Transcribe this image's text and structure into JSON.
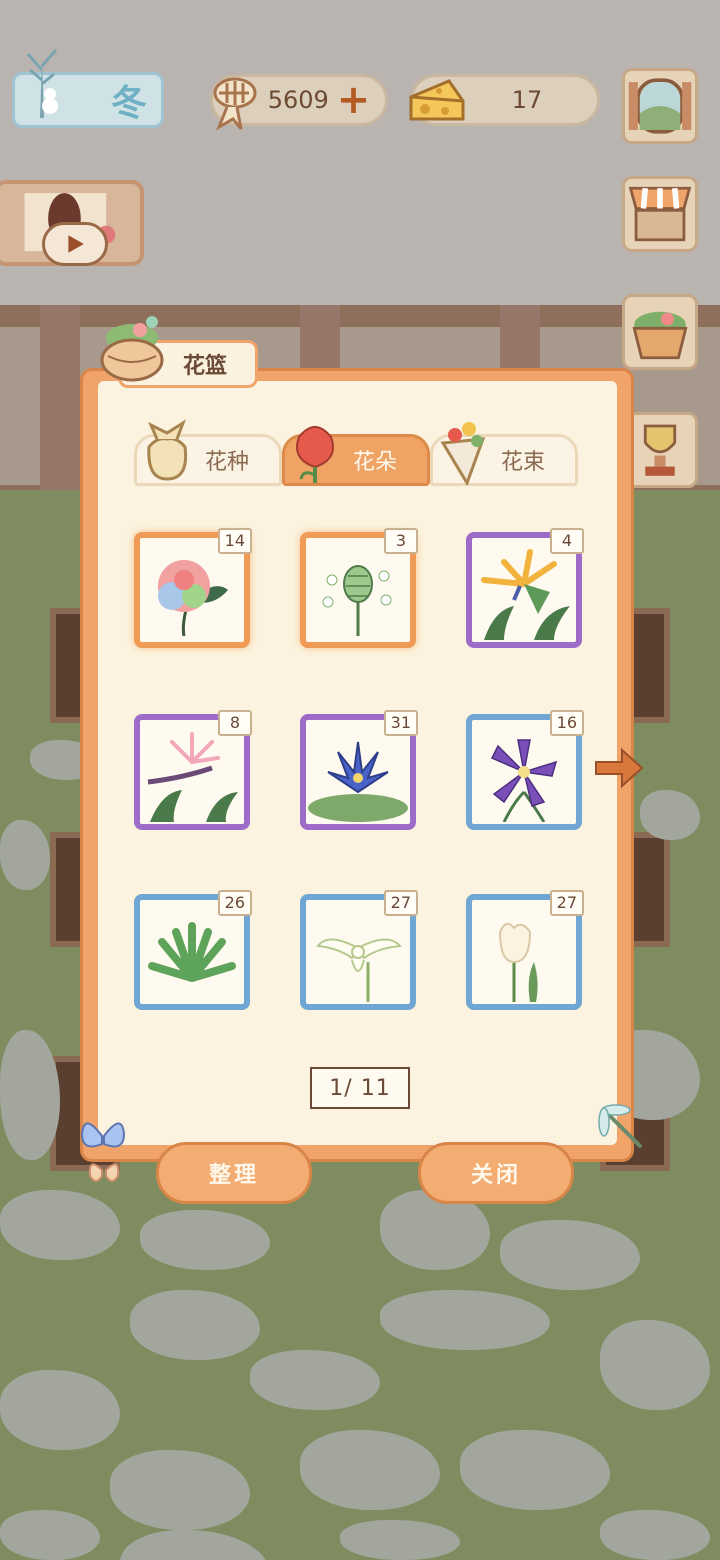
{
  "hud": {
    "season": "冬",
    "fish_bones": "5609",
    "cheese": "17"
  },
  "basket": {
    "title": "花篮",
    "tabs": [
      {
        "label": "花种",
        "icon": "seed-bag-icon",
        "active": false
      },
      {
        "label": "花朵",
        "icon": "red-flower-icon",
        "active": true
      },
      {
        "label": "花束",
        "icon": "bouquet-icon",
        "active": false
      }
    ],
    "items": [
      {
        "icon": "rainbow-rose-icon",
        "count": "14",
        "rarity": "orange"
      },
      {
        "icon": "green-artichoke-flower-icon",
        "count": "3",
        "rarity": "orange"
      },
      {
        "icon": "bird-of-paradise-icon",
        "count": "4",
        "rarity": "purple"
      },
      {
        "icon": "pink-bird-of-paradise-icon",
        "count": "8",
        "rarity": "purple"
      },
      {
        "icon": "blue-water-lily-icon",
        "count": "31",
        "rarity": "purple"
      },
      {
        "icon": "purple-clematis-icon",
        "count": "16",
        "rarity": "blue"
      },
      {
        "icon": "agave-plant-icon",
        "count": "26",
        "rarity": "blue"
      },
      {
        "icon": "white-egret-orchid-icon",
        "count": "27",
        "rarity": "blue"
      },
      {
        "icon": "white-tulip-icon",
        "count": "27",
        "rarity": "blue"
      }
    ],
    "pager": "1/ 11",
    "organize_label": "整理",
    "close_label": "关闭"
  },
  "colors": {
    "panel_orange": "#f0a46a",
    "panel_cream": "#fbf3df",
    "rarity_orange": "#ef9b56",
    "rarity_purple": "#9d6bc8",
    "rarity_blue": "#6fa6d3",
    "text_brown": "#6a4a36"
  }
}
